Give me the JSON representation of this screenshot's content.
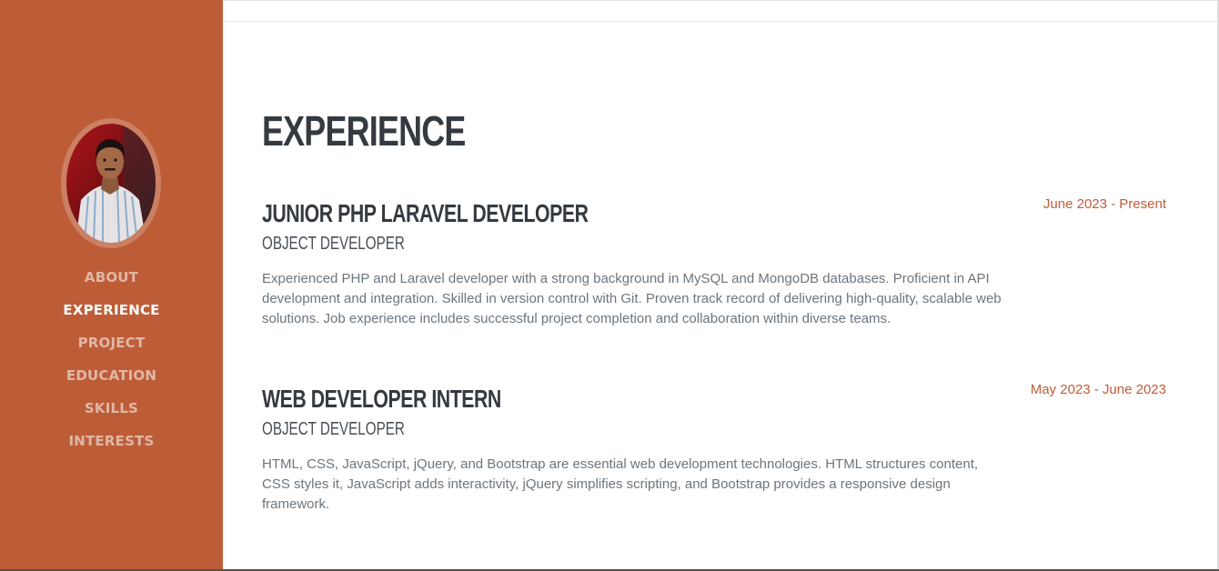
{
  "sidebar": {
    "nav": [
      {
        "label": "ABOUT",
        "active": false
      },
      {
        "label": "EXPERIENCE",
        "active": true
      },
      {
        "label": "PROJECT",
        "active": false
      },
      {
        "label": "EDUCATION",
        "active": false
      },
      {
        "label": "SKILLS",
        "active": false
      },
      {
        "label": "INTERESTS",
        "active": false
      }
    ]
  },
  "main": {
    "title": "EXPERIENCE",
    "experiences": [
      {
        "title": "JUNIOR PHP LARAVEL DEVELOPER",
        "company": "OBJECT DEVELOPER",
        "date": "June 2023 - Present",
        "description": "Experienced PHP and Laravel developer with a strong background in MySQL and MongoDB databases. Proficient in API development and integration. Skilled in version control with Git. Proven track record of delivering high-quality, scalable web solutions. Job experience includes successful project completion and collaboration within diverse teams."
      },
      {
        "title": "WEB DEVELOPER INTERN",
        "company": "OBJECT DEVELOPER",
        "date": "May 2023 - June 2023",
        "description": "HTML, CSS, JavaScript, jQuery, and Bootstrap are essential web development technologies. HTML structures content, CSS styles it, JavaScript adds interactivity, jQuery simplifies scripting, and Bootstrap provides a responsive design framework."
      }
    ]
  },
  "colors": {
    "accent": "#bd5d38",
    "heading": "#343a40",
    "body_text": "#6c757d"
  }
}
